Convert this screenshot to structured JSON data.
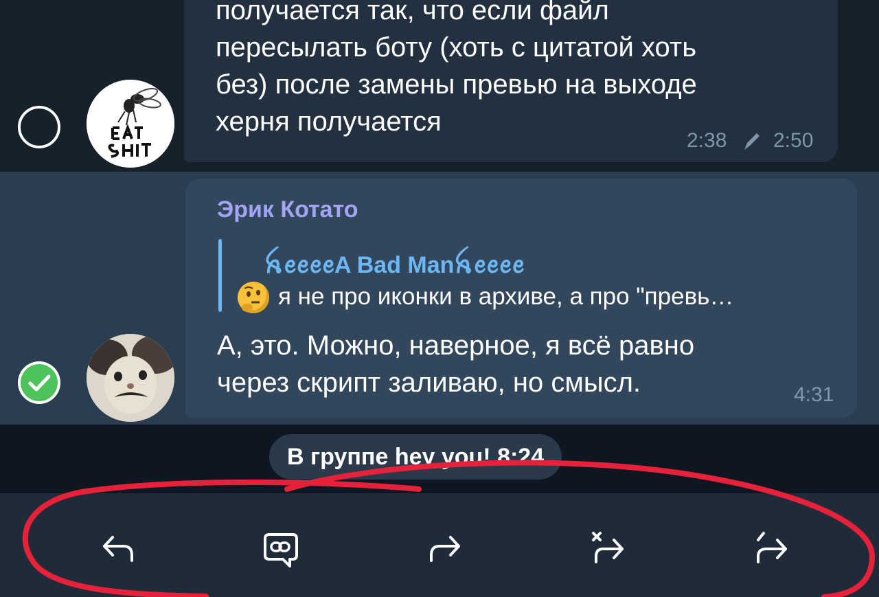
{
  "messages": [
    {
      "text": "получается так, что если файл\nпересылать боту (хоть с цитатой хоть\nбез) после замены превью на выходе\nхерня получается",
      "time": "2:38",
      "edited_time": "2:50",
      "selected": false,
      "avatar_text": "EAT SHIT"
    },
    {
      "sender": "Эрик Котато",
      "reply": {
        "name": "ꫝꫀꫀꫀꫀA Bad Manꫝꫀꫀꫀꫀ",
        "text": "я не про иконки в архиве, а про \"превь…"
      },
      "text": "А, это. Можно, наверное, я всё равно\nчерез скрипт заливаю, но смысл.",
      "time": "4:31",
      "selected": true
    }
  ],
  "service_message": "В группе hey you! 8:24",
  "toolbar": {
    "buttons": [
      {
        "icon": "reply-icon"
      },
      {
        "icon": "copy-link-icon"
      },
      {
        "icon": "forward-icon"
      },
      {
        "icon": "forward-without-author-icon"
      },
      {
        "icon": "forward-edit-icon"
      }
    ]
  },
  "colors": {
    "background": "#17212b",
    "selected_row": "#2b3d50",
    "check_green": "#4ec35c",
    "sender_name": "#a4a4f6",
    "reply_accent": "#6cb7f5",
    "annotation_red": "#e8213a"
  }
}
